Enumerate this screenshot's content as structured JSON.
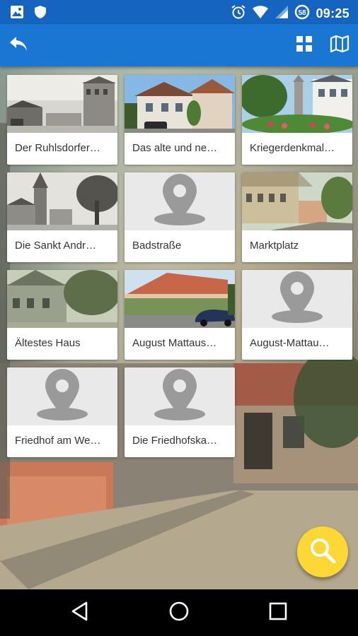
{
  "status_bar": {
    "time": "09:25",
    "left_icons": [
      "image-notification-icon",
      "shield-notification-icon"
    ],
    "right_icons": [
      "alarm-icon",
      "wifi-icon",
      "signal-icon",
      "battery-saver-icon"
    ]
  },
  "app_bar": {
    "back_icon": "reply-back-icon",
    "grid_icon": "grid-view-icon",
    "map_icon": "map-view-icon",
    "color": "#1976d2"
  },
  "places": [
    {
      "title": "Der Ruhlsdorfer…",
      "thumb": "photo-bw-street"
    },
    {
      "title": "Das alte und ne…",
      "thumb": "photo-houses"
    },
    {
      "title": "Kriegerdenkmal…",
      "thumb": "photo-memorial"
    },
    {
      "title": "Die Sankt Andr…",
      "thumb": "photo-bw-church"
    },
    {
      "title": "Badstraße",
      "thumb": "placeholder-pin"
    },
    {
      "title": "Marktplatz",
      "thumb": "photo-colored-street"
    },
    {
      "title": "Ältestes Haus",
      "thumb": "photo-old-house"
    },
    {
      "title": "August Mattaus…",
      "thumb": "photo-car-house"
    },
    {
      "title": "August-Mattau…",
      "thumb": "placeholder-pin"
    },
    {
      "title": "Friedhof am We…",
      "thumb": "placeholder-pin"
    },
    {
      "title": "Die Friedhofska…",
      "thumb": "placeholder-pin"
    }
  ],
  "fab": {
    "icon": "search-icon",
    "color": "#fdd835"
  },
  "nav_bar": {
    "icons": [
      "back-triangle-icon",
      "home-circle-icon",
      "recents-square-icon"
    ]
  }
}
